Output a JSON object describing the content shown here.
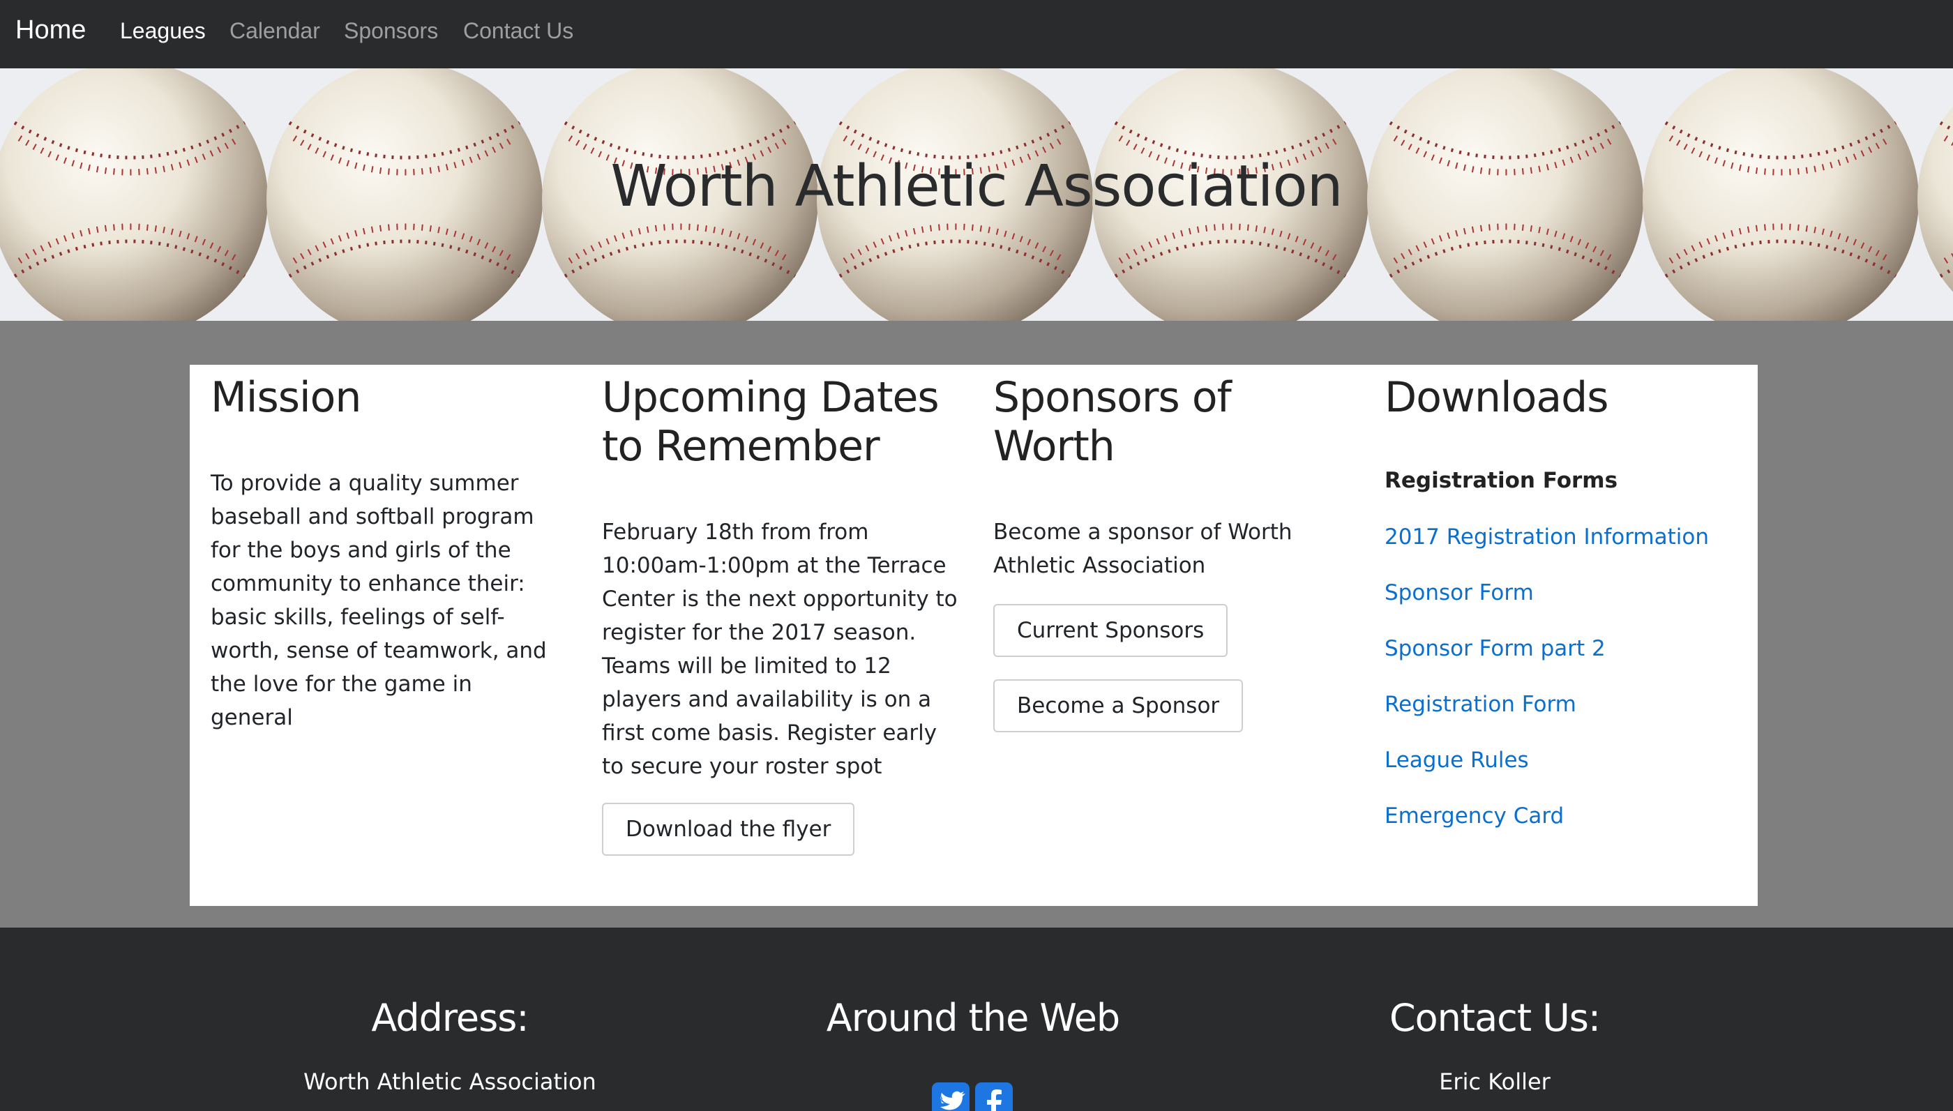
{
  "navbar": {
    "brand": "Home",
    "items": [
      {
        "label": "Leagues",
        "active": true
      },
      {
        "label": "Calendar",
        "active": false
      },
      {
        "label": "Sponsors",
        "active": false
      },
      {
        "label": "Contact Us",
        "active": false
      }
    ]
  },
  "hero": {
    "title": "Worth Athletic Association"
  },
  "mission": {
    "heading": "Mission",
    "body": "To provide a quality summer baseball and softball program for the boys and girls of the community to enhance their: basic skills, feelings of self-worth, sense of teamwork, and the love for the game in general"
  },
  "upcoming": {
    "heading": "Upcoming Dates to Remember",
    "body": "February 18th from from 10:00am-1:00pm at the Terrace Center is the next opportunity to register for the 2017 season. Teams will be limited to 12 players and availability is on a first come basis. Register early to secure your roster spot",
    "button": "Download the flyer"
  },
  "sponsors": {
    "heading": "Sponsors of Worth",
    "body": "Become a sponsor of Worth Athletic Association",
    "buttons": [
      "Current Sponsors",
      "Become a Sponsor"
    ]
  },
  "downloads": {
    "heading": "Downloads",
    "subheading": "Registration Forms",
    "links": [
      "2017 Registration Information",
      "Sponsor Form",
      "Sponsor Form part 2",
      "Registration Form",
      "League Rules",
      "Emergency Card"
    ]
  },
  "footer": {
    "address": {
      "heading": "Address:",
      "line1": "Worth Athletic Association"
    },
    "web": {
      "heading": "Around the Web",
      "icons": [
        "twitter-icon",
        "facebook-icon"
      ]
    },
    "contact": {
      "heading": "Contact Us:",
      "line1": "Eric Koller"
    }
  },
  "colors": {
    "navbar_bg": "#292b2c",
    "page_bg": "#7f7f7f",
    "link": "#0a6fcf",
    "social_icon": "#1d76e2"
  }
}
